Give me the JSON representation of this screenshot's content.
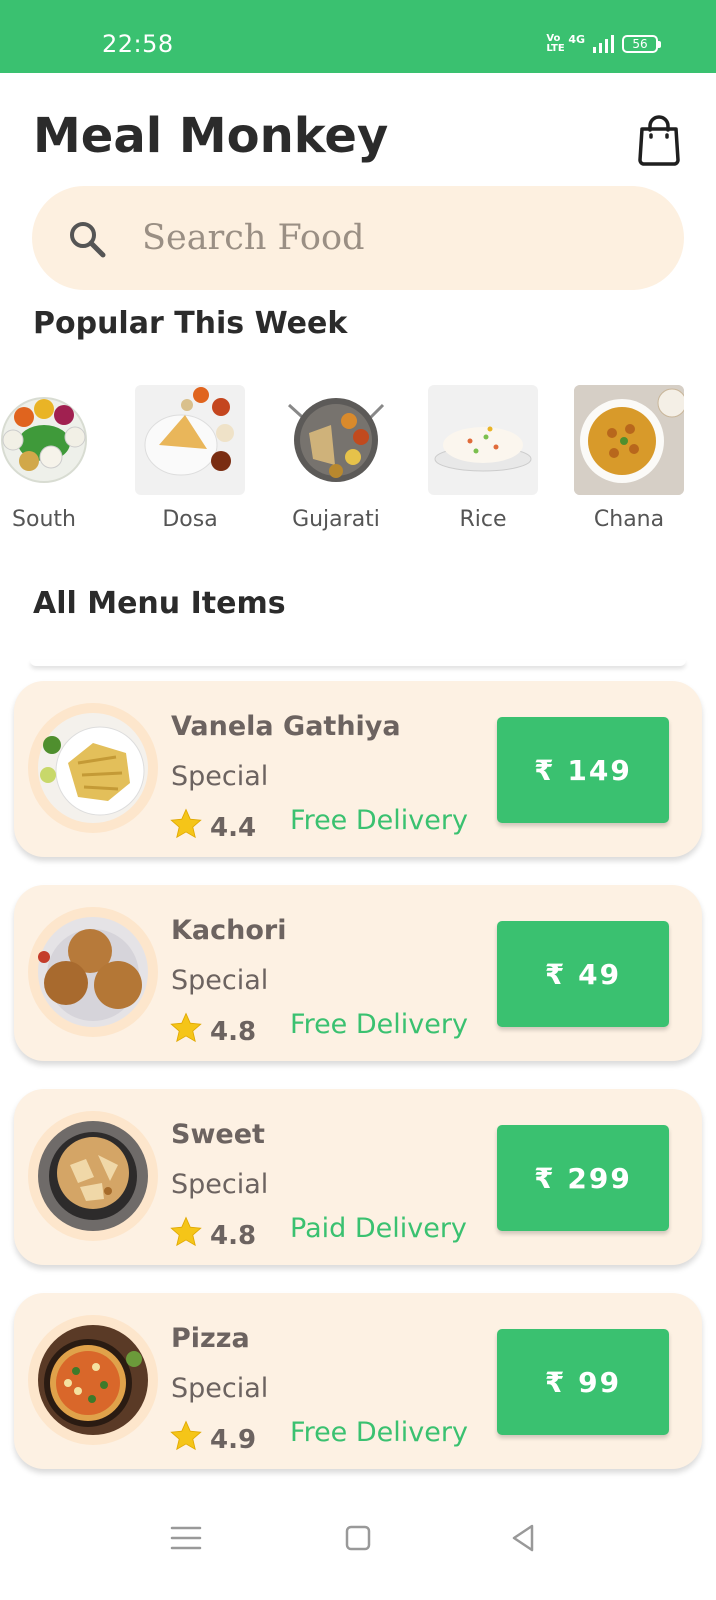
{
  "status_bar": {
    "time": "22:58",
    "volte": "Vo LTE",
    "network": "4G",
    "battery": "56"
  },
  "header": {
    "title": "Meal Monkey",
    "cart_icon": "shopping-bag-icon"
  },
  "search": {
    "placeholder": "Search Food",
    "icon": "search-icon"
  },
  "popular": {
    "title": "Popular This Week",
    "items": [
      {
        "label": "South"
      },
      {
        "label": "Dosa"
      },
      {
        "label": "Gujarati"
      },
      {
        "label": "Rice"
      },
      {
        "label": "Chana"
      }
    ]
  },
  "menu": {
    "title": "All Menu Items",
    "items": [
      {
        "name": "Vanela Gathiya",
        "subtitle": "Special",
        "rating": "4.4",
        "delivery": "Free Delivery",
        "price": "₹ 149"
      },
      {
        "name": "Kachori",
        "subtitle": "Special",
        "rating": "4.8",
        "delivery": "Free Delivery",
        "price": "₹ 49"
      },
      {
        "name": "Sweet",
        "subtitle": "Special",
        "rating": "4.8",
        "delivery": "Paid Delivery",
        "price": "₹ 299"
      },
      {
        "name": "Pizza",
        "subtitle": "Special",
        "rating": "4.9",
        "delivery": "Free Delivery",
        "price": "₹ 99"
      }
    ]
  },
  "colors": {
    "accent": "#3ac170",
    "card_bg": "#fdf1e3",
    "search_bg": "#fdf0e0",
    "star": "#f5c518"
  }
}
